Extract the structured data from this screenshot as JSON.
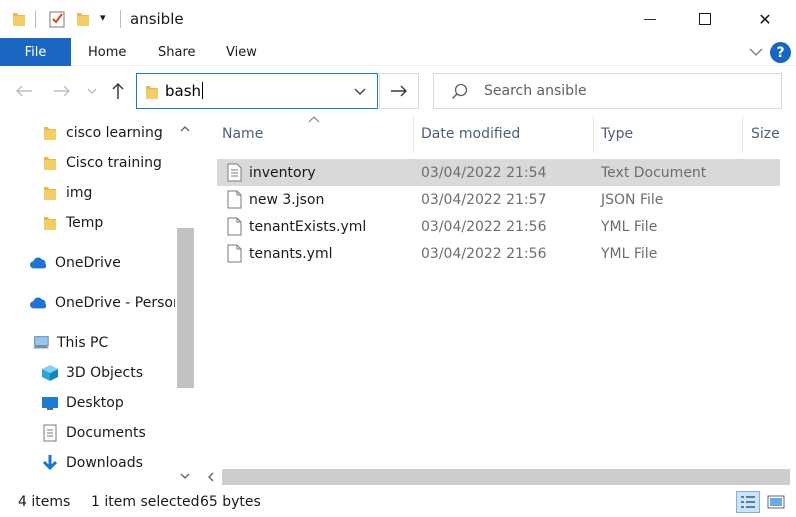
{
  "window": {
    "title": "ansible",
    "qat_dropdown_glyph": "▾",
    "minimize_glyph": "—",
    "close_glyph": "✕"
  },
  "ribbon": {
    "file_label": "File",
    "tabs": [
      "Home",
      "Share",
      "View"
    ],
    "help_label": "?"
  },
  "address": {
    "path_text": "bash",
    "search_placeholder": "Search ansible"
  },
  "nav_pane": {
    "items": [
      {
        "label": "cisco learning",
        "icon": "folder-icon"
      },
      {
        "label": "Cisco training",
        "icon": "folder-icon"
      },
      {
        "label": "img",
        "icon": "folder-icon"
      },
      {
        "label": "Temp",
        "icon": "folder-icon"
      },
      {
        "label": "OneDrive",
        "icon": "onedrive-cloud-icon"
      },
      {
        "label": "OneDrive - Person",
        "icon": "onedrive-cloud-icon"
      },
      {
        "label": "This PC",
        "icon": "computer-icon"
      },
      {
        "label": "3D Objects",
        "icon": "3d-objects-icon"
      },
      {
        "label": "Desktop",
        "icon": "desktop-icon"
      },
      {
        "label": "Documents",
        "icon": "documents-icon"
      },
      {
        "label": "Downloads",
        "icon": "downloads-icon"
      }
    ]
  },
  "file_list": {
    "columns": [
      "Name",
      "Date modified",
      "Type",
      "Size"
    ],
    "rows": [
      {
        "name": "inventory",
        "date": "03/04/2022 21:54",
        "type": "Text Document",
        "selected": true
      },
      {
        "name": "new 3.json",
        "date": "03/04/2022 21:57",
        "type": "JSON File",
        "selected": false
      },
      {
        "name": "tenantExists.yml",
        "date": "03/04/2022 21:56",
        "type": "YML File",
        "selected": false
      },
      {
        "name": "tenants.yml",
        "date": "03/04/2022 21:56",
        "type": "YML File",
        "selected": false
      }
    ]
  },
  "status_bar": {
    "item_count": "4 items",
    "selection": "1 item selected",
    "size": "65 bytes"
  },
  "colors": {
    "accent": "#1a66c1",
    "selection": "#d9d9d9",
    "folder": "#e8b84a"
  }
}
